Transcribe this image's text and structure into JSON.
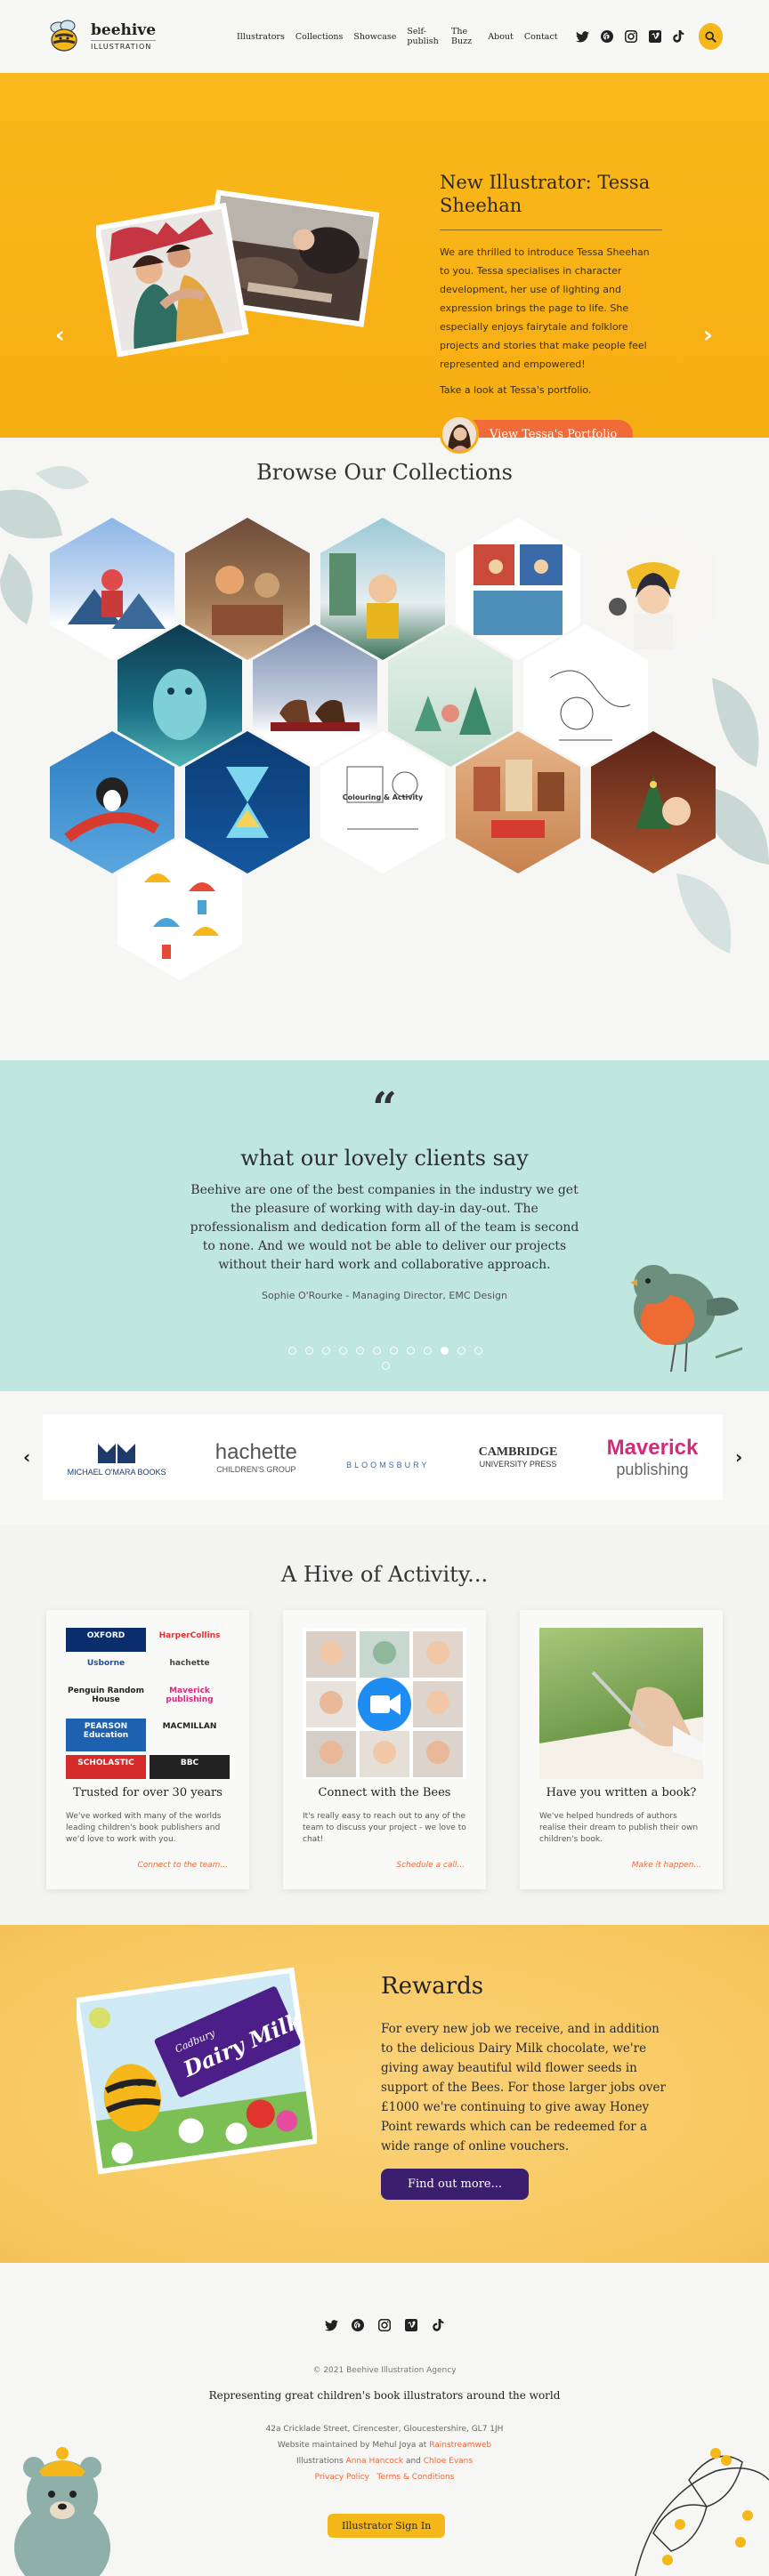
{
  "header": {
    "logo_name": "beehive",
    "logo_sub": "ILLUSTRATION",
    "nav": [
      "Illustrators",
      "Collections",
      "Showcase",
      "Self-publish",
      "The Buzz",
      "About",
      "Contact"
    ],
    "social_icons": [
      "twitter-icon",
      "pinterest-icon",
      "instagram-icon",
      "vimeo-icon",
      "tiktok-icon"
    ],
    "search_icon": "search-icon"
  },
  "hero": {
    "title": "New Illustrator: Tessa Sheehan",
    "description": "We are thrilled to introduce Tessa Sheehan to you. Tessa specialises in character development, her use of lighting and expression brings the page to life. She especially enjoys fairytale and folklore projects and stories that make people feel represented and empowered!",
    "cta_text": "Take a look at Tessa's portfolio.",
    "button_label": "View Tessa's Portfolio",
    "prev_icon": "chevron-left-icon",
    "next_icon": "chevron-right-icon",
    "slides_count": 9,
    "active_slide": 2
  },
  "collections": {
    "title": "Browse Our Collections",
    "colouring_label": "Colouring & Activity"
  },
  "testimonial": {
    "quote_mark": "“",
    "title": "what our lovely clients say",
    "body": "Beehive are one of the best companies in the industry we get the pleasure of working with day-in day-out. The professionalism and dedication form all of the team is second to none. And we would not be able to deliver our projects without their hard work and collaborative approach.",
    "author": "Sophie O'Rourke - Managing Director, EMC Design",
    "dots_count": 13,
    "active_dot": 10
  },
  "publishers": {
    "items": [
      {
        "name": "MICHAEL O'MARA BOOKS"
      },
      {
        "name": "hachette",
        "sub": "CHILDREN'S GROUP"
      },
      {
        "name": "BLOOMSBURY"
      },
      {
        "name": "CAMBRIDGE",
        "sub": "UNIVERSITY PRESS"
      },
      {
        "name": "Maverick",
        "sub": "publishing"
      }
    ]
  },
  "activity": {
    "title": "A Hive of Activity...",
    "cards": [
      {
        "title": "Trusted for over 30 years",
        "desc": "We've worked with many of the worlds leading children's book publishers and we'd love to work with you.",
        "link": "Connect to the team..."
      },
      {
        "title": "Connect with the Bees",
        "desc": "It's really easy to reach out to any of the team to discuss your project - we love to chat!",
        "link": "Schedule a call..."
      },
      {
        "title": "Have you written a book?",
        "desc": "We've helped hundreds of authors realise their dream to publish their own children's book.",
        "link": "Make it happen..."
      }
    ],
    "publisher_logos": [
      "OXFORD",
      "HarperCollins",
      "Usborne",
      "hachette",
      "Penguin Random House",
      "Maverick publishing",
      "PEARSON Education",
      "MACMILLAN",
      "SCHOLASTIC",
      "BBC"
    ]
  },
  "rewards": {
    "title": "Rewards",
    "body": "For every new job we receive, and in addition to the delicious Dairy Milk chocolate, we're giving away beautiful wild flower seeds in support of the Bees. For those larger jobs over £1000 we're continuing to give away Honey Point rewards which can be redeemed for a wide range of online vouchers.",
    "button_label": "Find out more...",
    "chocolate_brand": "Cadbury",
    "chocolate_name": "Dairy Milk"
  },
  "footer": {
    "copyright": "© 2021 Beehive Illustration Agency",
    "tagline": "Representing great children's book illustrators around the world",
    "address": "42a Cricklade Street, Cirencester, Gloucestershire, GL7 1JH",
    "maintained_prefix": "Website maintained by Mehul Joya at ",
    "maintained_link": "Rainstreamweb",
    "illustrations_prefix": "Illustrations ",
    "illustrator_1": "Anna Hancock",
    "illustrations_and": " and ",
    "illustrator_2": "Chloe Evans",
    "privacy": "Privacy Policy",
    "terms": "Terms & Conditions",
    "signin": "Illustrator Sign In"
  },
  "colors": {
    "accent_yellow": "#f5b71a",
    "accent_orange": "#f06a3a",
    "mint": "#bfe6df",
    "purple": "#3b1e6e"
  }
}
